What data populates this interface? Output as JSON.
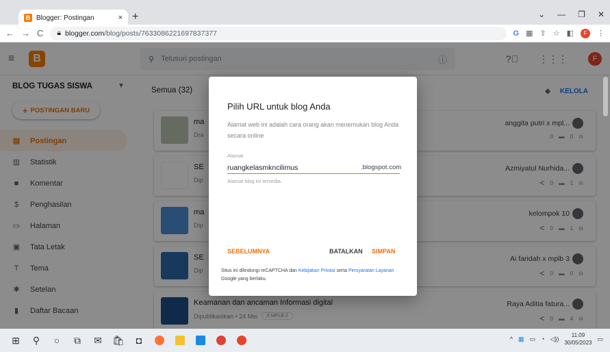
{
  "browser": {
    "tab_title": "Blogger: Postingan",
    "tab_close": "×",
    "new_tab": "+",
    "url_domain": "blogger.com",
    "url_path": "/blog/posts/7633086221697837377",
    "profile_initial": "F",
    "window_controls": [
      "⌄",
      "—",
      "❐",
      "✕"
    ]
  },
  "header": {
    "logo_letter": "B",
    "search_placeholder": "Telusuri postingan",
    "avatar_initial": "F"
  },
  "sidebar": {
    "blog_name": "BLOG TUGAS SISWA",
    "new_post_label": "POSTINGAN BARU",
    "items": [
      {
        "label": "Postingan",
        "icon": "▤"
      },
      {
        "label": "Statistik",
        "icon": "▥"
      },
      {
        "label": "Komentar",
        "icon": "■"
      },
      {
        "label": "Penghasilan",
        "icon": "$"
      },
      {
        "label": "Halaman",
        "icon": "▭"
      },
      {
        "label": "Tata Letak",
        "icon": "▣"
      },
      {
        "label": "Tema",
        "icon": "T"
      },
      {
        "label": "Setelan",
        "icon": "✱"
      },
      {
        "label": "Daftar Bacaan",
        "icon": "▮"
      }
    ]
  },
  "main": {
    "filter_label": "Semua (32)",
    "manage_label": "KELOLA",
    "posts": [
      {
        "title": "ma",
        "meta": "Dra",
        "chip": "",
        "author": "anggita putri x mpl...",
        "comments": "0",
        "views": "0",
        "thumb_color": "#b8c4b0"
      },
      {
        "title": "SE",
        "meta": "Dip",
        "chip": "",
        "author": "Azmiyatul Nurhida...",
        "comments": "0",
        "views": "1",
        "thumb_color": "#ffffff"
      },
      {
        "title": "ma",
        "meta": "Dip",
        "chip": "",
        "author": "kelompok 10",
        "comments": "0",
        "views": "1",
        "thumb_color": "#4a8fd6"
      },
      {
        "title": "SE",
        "meta": "Dip",
        "chip": "",
        "author": "Ai faridah x mplb 3",
        "comments": "0",
        "views": "0",
        "thumb_color": "#2a6aa8"
      },
      {
        "title": "Keamanan dan ancaman Informasi digital",
        "meta": "Dipublikasikan • 24 Mei",
        "chip": "X MPLB 2",
        "author": "Raya Aditia fatura...",
        "comments": "0",
        "views": "4",
        "thumb_color": "#1e4f86"
      }
    ]
  },
  "dialog": {
    "title": "Pilih URL untuk blog Anda",
    "description": "Alamat web ini adalah cara orang akan menemukan blog Anda secara online",
    "field_label": "Alamat",
    "field_value": "ruangkelasmkncilimus",
    "field_suffix": ".blogspot.com",
    "field_hint": "Alamat blog ini tersedia.",
    "btn_prev": "SEBELUMNYA",
    "btn_cancel": "BATALKAN",
    "btn_save": "SIMPAN",
    "footer_pre": "Situs ini dilindungi reCAPTCHA dan ",
    "footer_link1": "Kebijakan Privasi",
    "footer_mid": " serta ",
    "footer_link2": "Persyaratan Layanan",
    "footer_post": " Google yang berlaku."
  },
  "taskbar": {
    "time": "11.09",
    "date": "30/05/2023"
  },
  "colors": {
    "accent": "#e8710a",
    "link": "#1a73e8"
  }
}
